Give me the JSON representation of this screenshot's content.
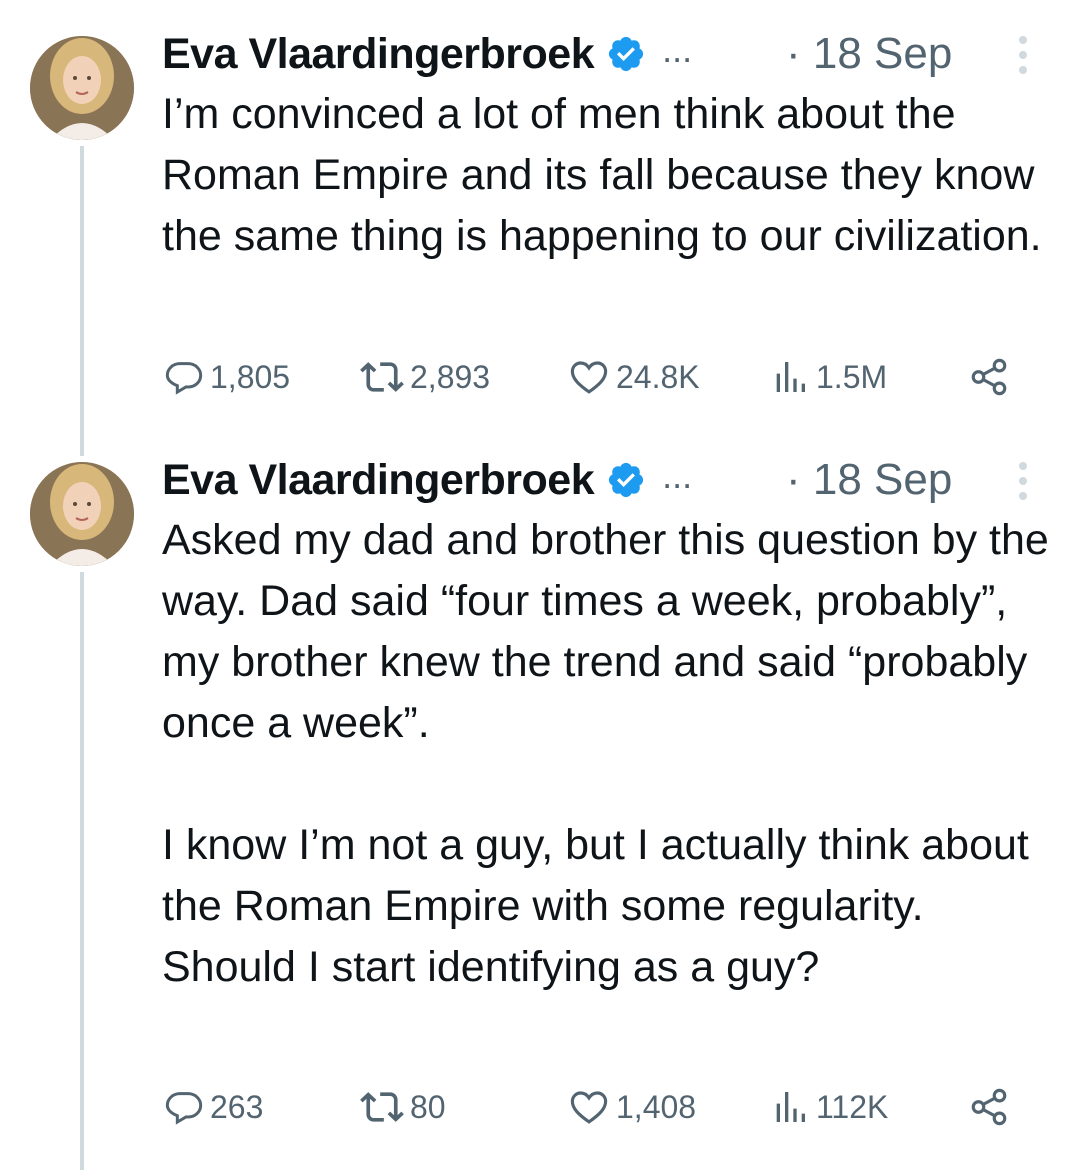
{
  "tweets": [
    {
      "author": "Eva Vlaardingerbroek",
      "ellipsis": "...",
      "time": "· 18 Sep",
      "paragraphs": [
        "I’m convinced a lot of men think about the Roman Empire and its fall because they know the same thing is happening to our civilization."
      ],
      "replies": "1,805",
      "retweets": "2,893",
      "likes": "24.8K",
      "views": "1.5M"
    },
    {
      "author": "Eva Vlaardingerbroek",
      "ellipsis": "...",
      "time": "· 18 Sep",
      "paragraphs": [
        "Asked my dad and brother this question by the way. Dad said “four times a week, probably”, my brother knew the trend and said “probably once a week”.",
        "I know I’m not a guy, but I actually think about the Roman Empire with some regularity. Should I start identifying as a guy?"
      ],
      "replies": "263",
      "retweets": "80",
      "likes": "1,408",
      "views": "112K"
    }
  ],
  "icons": {
    "reply": "reply-icon",
    "retweet": "retweet-icon",
    "like": "like-icon",
    "views": "views-icon",
    "share": "share-icon",
    "verified": "verified-badge-icon",
    "more": "more-options-icon"
  },
  "colors": {
    "text": "#0f1419",
    "secondary": "#536471",
    "verified": "#1d9bf0",
    "thread_line": "#cfd9de"
  }
}
